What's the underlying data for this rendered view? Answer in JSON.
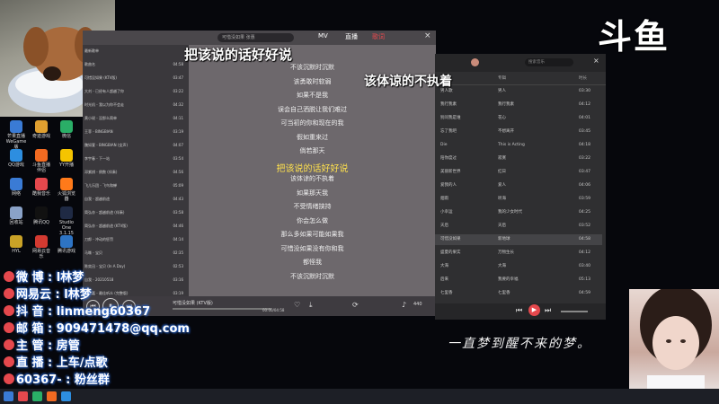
{
  "brand": {
    "logo_text": "斗鱼"
  },
  "desktop": {
    "icons": [
      {
        "label": "芒果直播 WeGame版",
        "color": "#3a7bd5"
      },
      {
        "label": "奇迹游戏",
        "color": "#e0a030"
      },
      {
        "label": "微信",
        "color": "#2aae67"
      },
      {
        "label": "QQ游戏",
        "color": "#2d8ee0"
      },
      {
        "label": "斗鱼直播伴侣",
        "color": "#f26a21"
      },
      {
        "label": "YY开播",
        "color": "#f5c400"
      },
      {
        "label": "网络",
        "color": "#3a7bd5"
      },
      {
        "label": "酷我音乐",
        "color": "#e5484d"
      },
      {
        "label": "火狐浏览器",
        "color": "#ff7a1a"
      },
      {
        "label": "回收站",
        "color": "#8aa2c8"
      },
      {
        "label": "腾讯QQ",
        "color": "#111111"
      },
      {
        "label": "Studio One 3.1.15",
        "color": "#1f2a44"
      },
      {
        "label": "HYL",
        "color": "#c9a227"
      },
      {
        "label": "网易云音乐",
        "color": "#d33a31"
      },
      {
        "label": "腾讯游戏",
        "color": "#2e74c4"
      }
    ]
  },
  "left_player": {
    "title_bar_text": "可惜没如果 (KTV版)",
    "tabs": [
      "MV",
      "直播",
      "歌词"
    ],
    "search_placeholder": "可惜没如果 张惠",
    "playlist": [
      {
        "title": "最新歌单",
        "dur": ""
      },
      {
        "title": "歌曲名",
        "dur": "04:58"
      },
      {
        "title": "可惜没如果 (KTV版)",
        "dur": "03:47"
      },
      {
        "title": "大刘 - 已经有人超越了你",
        "dur": "03:22"
      },
      {
        "title": "时光机 - 我以为你不会走",
        "dur": "04:32"
      },
      {
        "title": "黄小琥 - 没那么简单",
        "dur": "04:11"
      },
      {
        "title": "王菲 - BINGBIAN",
        "dur": "03:19"
      },
      {
        "title": "魏如萱 - BINGBIAN (女声)",
        "dur": "04:07"
      },
      {
        "title": "李宇春 - 下一站",
        "dur": "03:54"
      },
      {
        "title": "邓紫棋 - 倒数 (伴奏)",
        "dur": "04:56"
      },
      {
        "title": "飞儿乐团 - 飞鸟和蝉",
        "dur": "05:09"
      },
      {
        "title": "自我 - 超越前途",
        "dur": "04:43"
      },
      {
        "title": "简弘亦 - 超越前途 (伴奏)",
        "dur": "03:58"
      },
      {
        "title": "简弘亦 - 超越前途 (KTV版)",
        "dur": "04:46"
      },
      {
        "title": "刀郎 - 冲动的惩罚",
        "dur": "04:14"
      },
      {
        "title": "马嘶 - 宝贝",
        "dur": "02:35"
      },
      {
        "title": "陈奕迅 - 宝贝 (In A Day)",
        "dur": "02:53"
      },
      {
        "title": "自我 - 20210518",
        "dur": "03:16"
      },
      {
        "title": "林宥嘉 - 最佳听众 (完整版)",
        "dur": "03:19"
      }
    ],
    "now_playing": "可惜没如果 (KTV版)",
    "time": "00:00/04:58",
    "count": "440"
  },
  "lyrics": {
    "lines": [
      "不该沉默时沉默",
      "该勇敢时软弱",
      "如果不是我",
      "误会自己洒脱让我们难过",
      "可当初的你和现在的我",
      "假如重来过",
      "倘若那天",
      "把该说的话好好说",
      "该体谅的不执着",
      "如果那天我",
      "不受情绪挟持",
      "你会怎么做",
      "那么多如果可能如果我",
      "可惜没如果没有你和我",
      "都怪我",
      "不该沉默时沉默"
    ],
    "highlight_index": 7
  },
  "right_window": {
    "header_left": "标题",
    "header_mid": "专辑",
    "header_right": "时长",
    "search_placeholder": "搜索音乐",
    "rows": [
      {
        "a": "男人歌",
        "b": "男人",
        "c": "03:30"
      },
      {
        "a": "我行我素",
        "b": "我行我素",
        "c": "04:12"
      },
      {
        "a": "别问我是谁",
        "b": "花心",
        "c": "04:01"
      },
      {
        "a": "忘了我吧",
        "b": "不想离开",
        "c": "03:45"
      },
      {
        "a": "Die",
        "b": "This is Acting",
        "c": "04:18"
      },
      {
        "a": "陪你度过",
        "b": "寂寞",
        "c": "03:22"
      },
      {
        "a": "美丽新世界",
        "b": "红日",
        "c": "03:47"
      },
      {
        "a": "爱我的人",
        "b": "爱人",
        "c": "04:06"
      },
      {
        "a": "烟雨",
        "b": "听海",
        "c": "03:59"
      },
      {
        "a": "小幸运",
        "b": "我的少女时代",
        "c": "04:25"
      },
      {
        "a": "天后",
        "b": "天后",
        "c": "03:52"
      },
      {
        "a": "可惜没如果",
        "b": "新地球",
        "c": "04:58"
      },
      {
        "a": "盛夏的果实",
        "b": "万物生长",
        "c": "04:12"
      },
      {
        "a": "大海",
        "b": "大海",
        "c": "03:40"
      },
      {
        "a": "后来",
        "b": "我要的幸福",
        "c": "05:13"
      },
      {
        "a": "七里香",
        "b": "七里香",
        "c": "04:59"
      }
    ],
    "highlight_index": 11
  },
  "overlays": {
    "lyric_main": "把该说的话好好说",
    "lyric_sub": "该体谅的不执着",
    "handwriting": "一直梦到醒不来的梦。"
  },
  "streamer_info": [
    {
      "key": "微 博",
      "val": "l林梦"
    },
    {
      "key": "网易云",
      "val": "l林梦"
    },
    {
      "key": "抖 音",
      "val": "linmeng60367"
    },
    {
      "key": "邮 箱",
      "val": "909471478@qq.com"
    },
    {
      "key": "主 管",
      "val": "房管"
    },
    {
      "key": "直 播",
      "val": "上车/点歌"
    },
    {
      "key": "60367-",
      "val": "粉丝群"
    }
  ],
  "colors": {
    "accent_red": "#e5484d",
    "lyric_yellow": "#ffe14d",
    "info_glow": "#2a6ad8"
  }
}
